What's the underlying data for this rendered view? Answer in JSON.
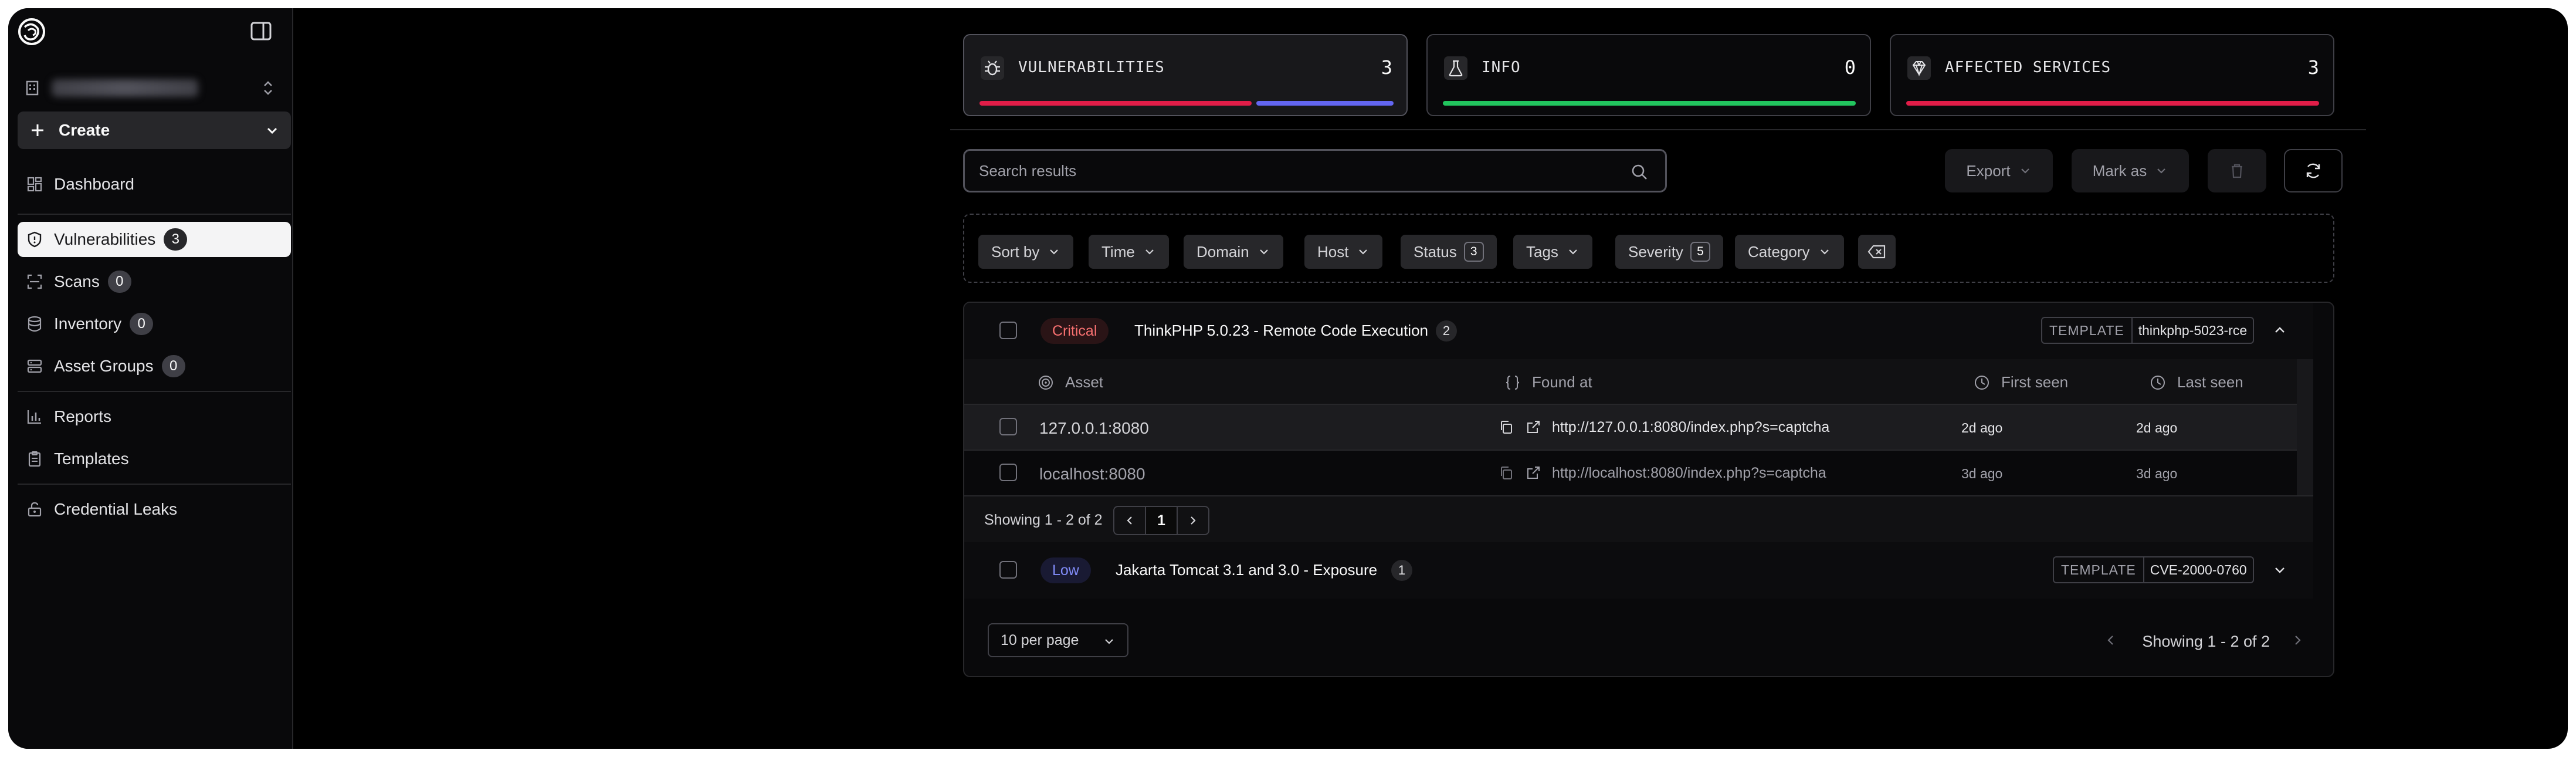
{
  "sidebar": {
    "create_label": "Create",
    "nav": [
      {
        "label": "Dashboard",
        "icon": "dashboard-icon"
      },
      {
        "label": "Vulnerabilities",
        "count": "3",
        "icon": "shield-icon"
      },
      {
        "label": "Scans",
        "count": "0",
        "icon": "scan-icon"
      },
      {
        "label": "Inventory",
        "count": "0",
        "icon": "database-icon"
      },
      {
        "label": "Asset Groups",
        "count": "0",
        "icon": "server-icon"
      },
      {
        "label": "Reports",
        "icon": "bar-chart-icon"
      },
      {
        "label": "Templates",
        "icon": "clipboard-icon"
      },
      {
        "label": "Credential Leaks",
        "icon": "unlock-icon"
      }
    ]
  },
  "stats": [
    {
      "label": "VULNERABILITIES",
      "value": "3",
      "icon": "bug-icon",
      "colors": [
        "#e11d48",
        "#6366f1"
      ]
    },
    {
      "label": "INFO",
      "value": "0",
      "icon": "flask-icon",
      "colors": [
        "#22c55e"
      ]
    },
    {
      "label": "AFFECTED SERVICES",
      "value": "3",
      "icon": "gem-icon",
      "colors": [
        "#e11d48"
      ]
    }
  ],
  "toolbar": {
    "search_placeholder": "Search results",
    "export_label": "Export",
    "mark_as_label": "Mark as"
  },
  "filters": {
    "sort_by": "Sort by",
    "time": "Time",
    "domain": "Domain",
    "host": "Host",
    "status": "Status",
    "status_count": "3",
    "tags": "Tags",
    "severity": "Severity",
    "severity_count": "5",
    "category": "Category"
  },
  "groups": [
    {
      "severity": "Critical",
      "title": "ThinkPHP 5.0.23 - Remote Code Execution",
      "count": "2",
      "template_key": "TEMPLATE",
      "template_id": "thinkphp-5023-rce",
      "columns": {
        "asset": "Asset",
        "found_at": "Found at",
        "first_seen": "First seen",
        "last_seen": "Last seen"
      },
      "rows": [
        {
          "asset": "127.0.0.1:8080",
          "url": "http://127.0.0.1:8080/index.php?s=captcha",
          "first_seen": "2d ago",
          "last_seen": "2d ago"
        },
        {
          "asset": "localhost:8080",
          "url": "http://localhost:8080/index.php?s=captcha",
          "first_seen": "3d ago",
          "last_seen": "3d ago"
        }
      ],
      "pager": {
        "showing": "Showing 1 - 2 of 2",
        "page": "1"
      }
    },
    {
      "severity": "Low",
      "title": "Jakarta Tomcat 3.1 and 3.0 - Exposure",
      "count": "1",
      "template_key": "TEMPLATE",
      "template_id": "CVE-2000-0760"
    }
  ],
  "footer": {
    "per_page": "10 per page",
    "showing": "Showing 1 - 2 of 2"
  },
  "colors": {
    "critical": "#f87171",
    "low": "#818cf8",
    "background": "#000000"
  }
}
